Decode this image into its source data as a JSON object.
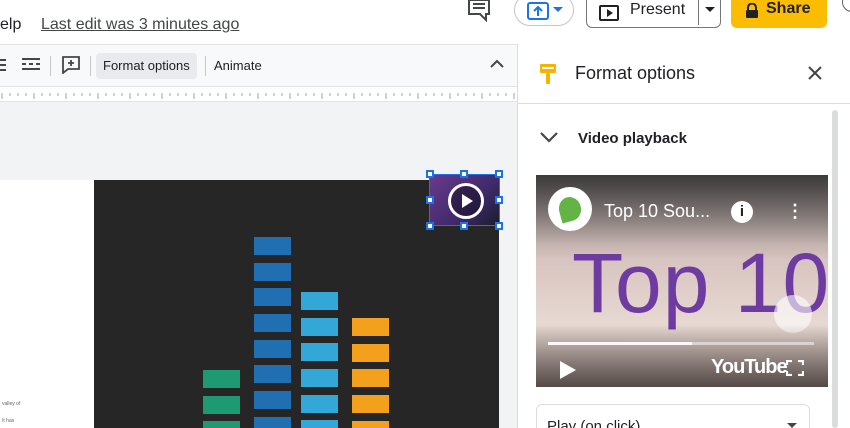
{
  "topbar": {
    "menu_help": "elp",
    "last_edit": "Last edit was 3 minutes ago",
    "present_label": "Present",
    "share_label": "Share",
    "icons": [
      "comment-icon",
      "upload-icon",
      "present-icon",
      "lock-icon"
    ]
  },
  "toolbar": {
    "format_options_label": "Format options",
    "animate_label": "Animate"
  },
  "slide": {
    "side_text_1": "valley of",
    "side_text_2": "It has",
    "equalizer": {
      "colors": {
        "green": "#1e9a73",
        "blue": "#1f6fb2",
        "light_blue": "#33a8d8",
        "orange": "#f3a01c"
      }
    }
  },
  "panel": {
    "title": "Format options",
    "section_title": "Video playback",
    "video": {
      "title": "Top 10 Sou...",
      "big_text": "Top 10",
      "brand": "YouTube",
      "progress": 0.54
    },
    "playback_select_value": "Play (on click)"
  },
  "colors": {
    "share": "#fbbc04",
    "accent": "#1a73e8",
    "panel_icon": "#f4b400"
  }
}
